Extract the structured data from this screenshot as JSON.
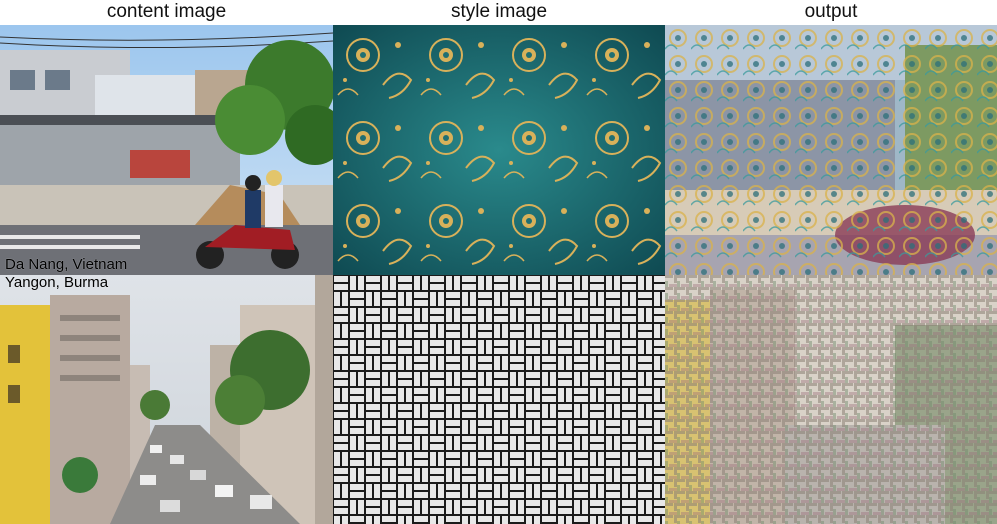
{
  "headers": {
    "content": "content image",
    "style": "style image",
    "output": "output"
  },
  "captions": {
    "row1": "Da Nang, Vietnam",
    "row2": "Yangon, Burma"
  },
  "colors": {
    "style_teal": "#1f6f73",
    "style_gold": "#d8b15a",
    "weave_dark": "#1b1b1b",
    "weave_light": "#e8e8e8"
  }
}
